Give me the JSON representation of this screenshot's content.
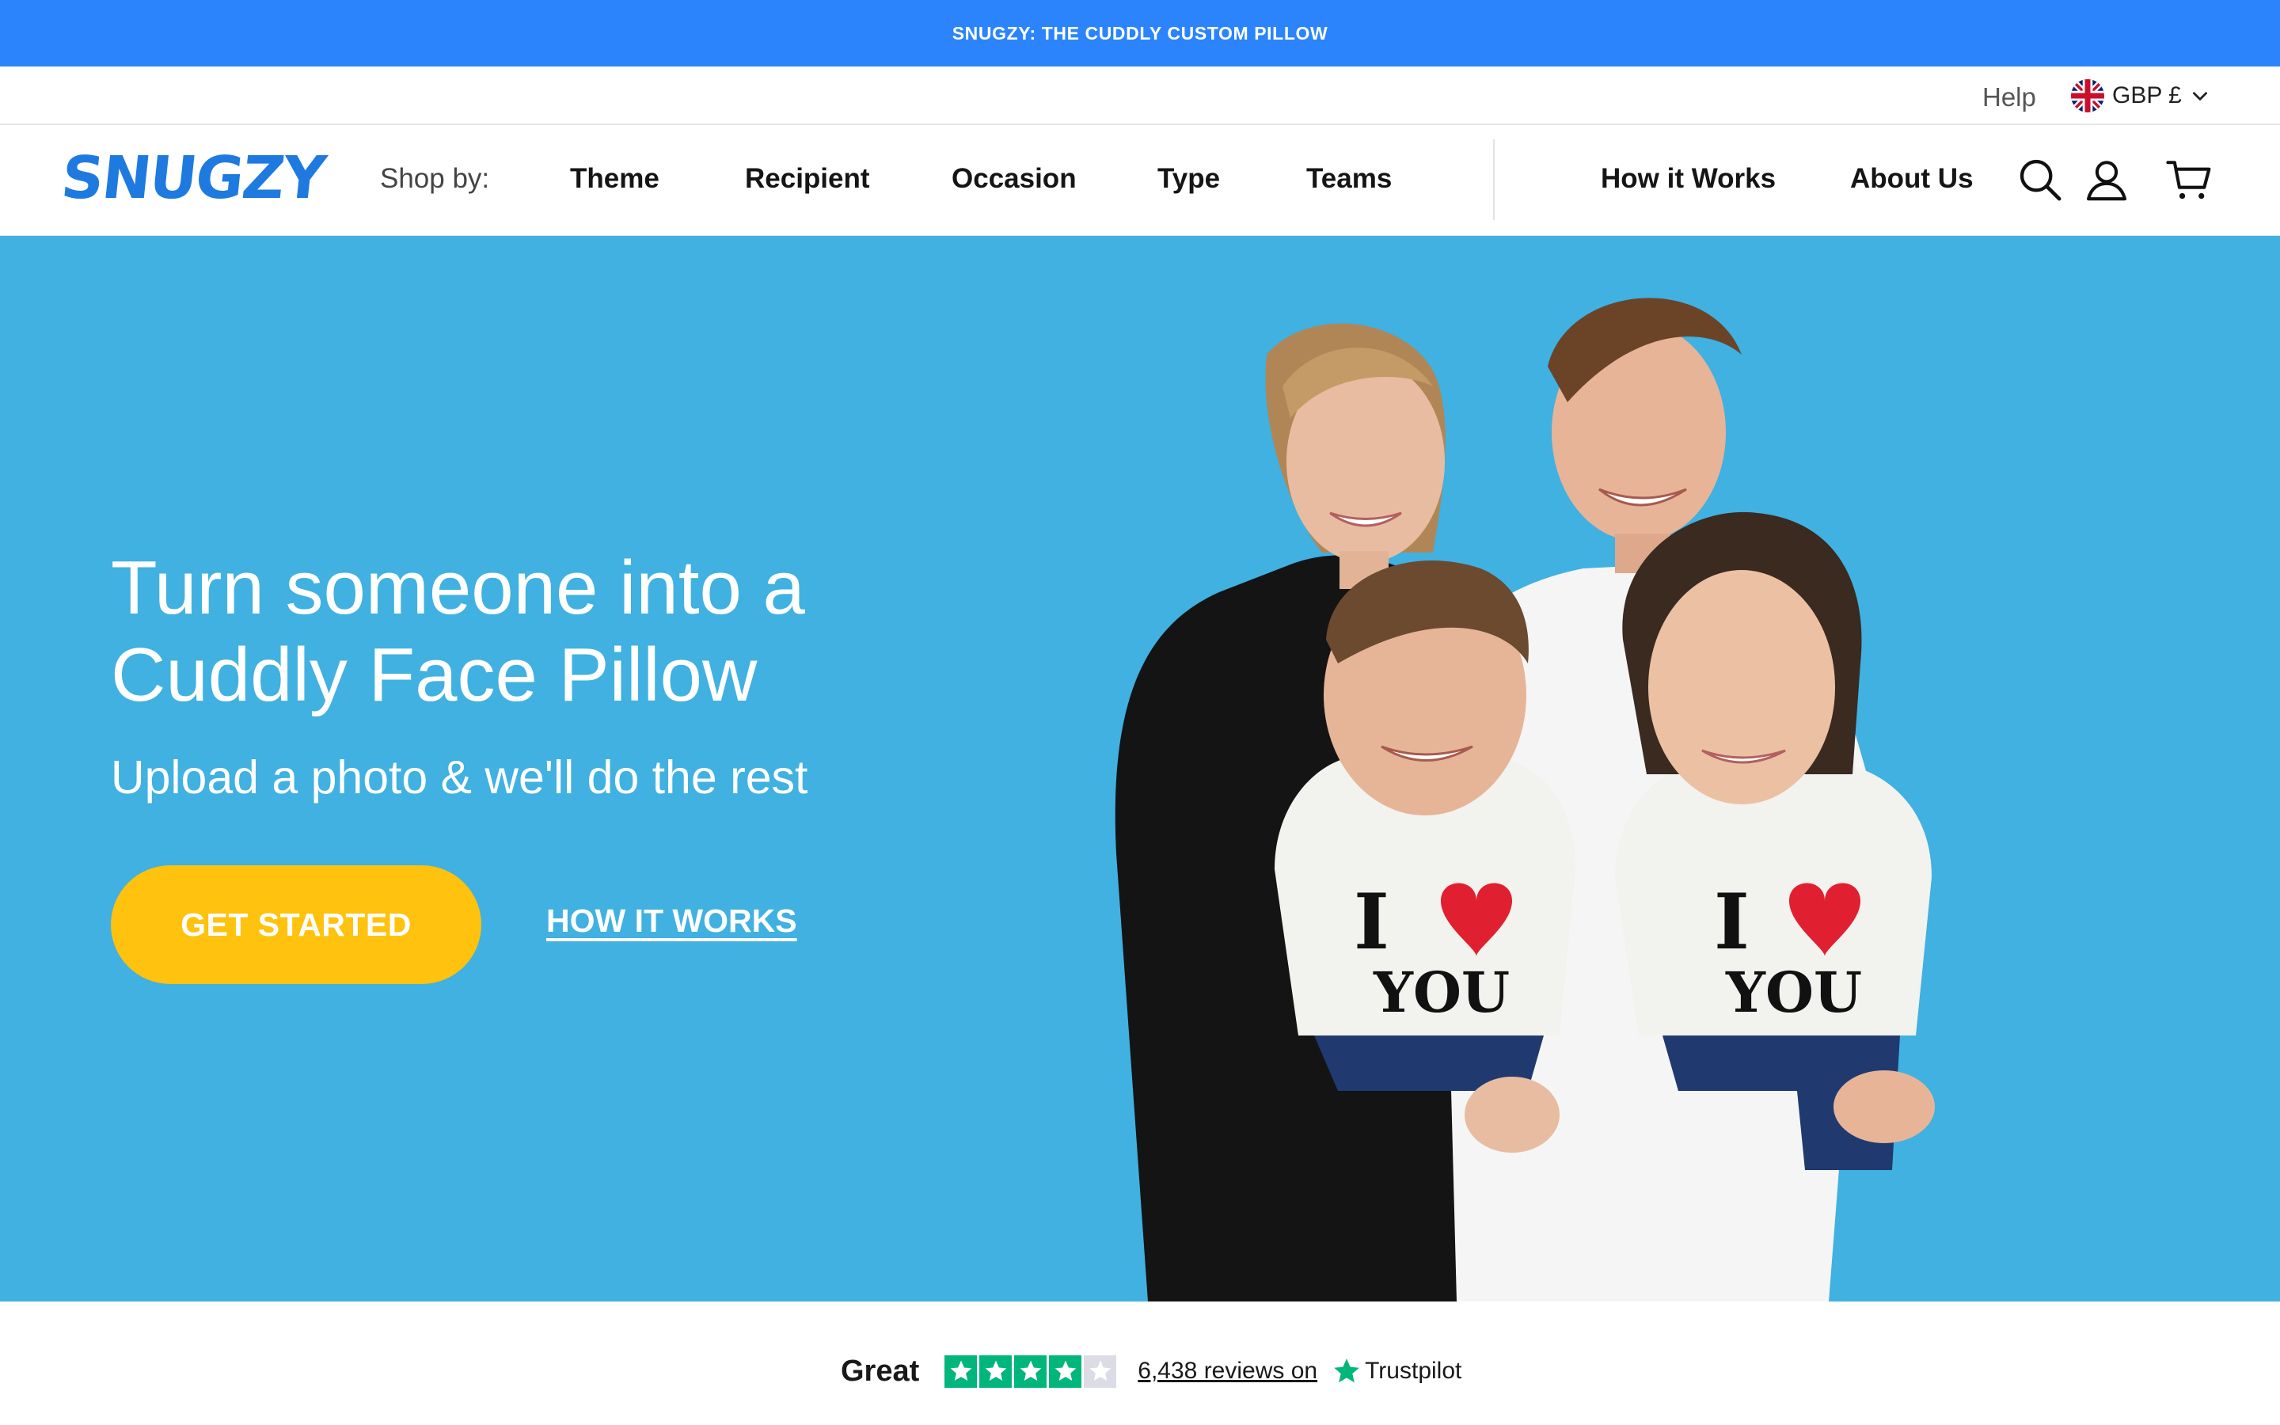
{
  "announcement": {
    "text": "SNUGZY: THE CUDDLY CUSTOM PILLOW"
  },
  "utility": {
    "help_label": "Help",
    "currency_label": "GBP £",
    "currency_flag": "uk-flag-icon"
  },
  "header": {
    "logo_text": "SNUGZY",
    "shop_by_label": "Shop by:",
    "shop_links": [
      "Theme",
      "Recipient",
      "Occasion",
      "Type",
      "Teams"
    ],
    "info_links": [
      "How it Works",
      "About Us"
    ],
    "icons": [
      "search-icon",
      "account-icon",
      "cart-icon"
    ]
  },
  "hero": {
    "headline": "Turn someone into a Cuddly Face Pillow",
    "subline": "Upload a photo & we'll do the rest",
    "primary_cta": "GET STARTED",
    "secondary_cta": "HOW IT WORKS",
    "shirt_print_line1": "I",
    "shirt_print_line2": "YOU"
  },
  "reviews": {
    "rating_word": "Great",
    "stars_filled": 4,
    "stars_total": 5,
    "count_text": "6,438 reviews on",
    "provider": "Trustpilot"
  },
  "colors": {
    "announcement_bg": "#2b84fb",
    "brand_blue": "#1f7ae0",
    "hero_bg": "#40b1e0",
    "cta_yellow": "#ffc20e",
    "trustpilot_green": "#00b67a",
    "star_grey": "#dcdce6"
  }
}
